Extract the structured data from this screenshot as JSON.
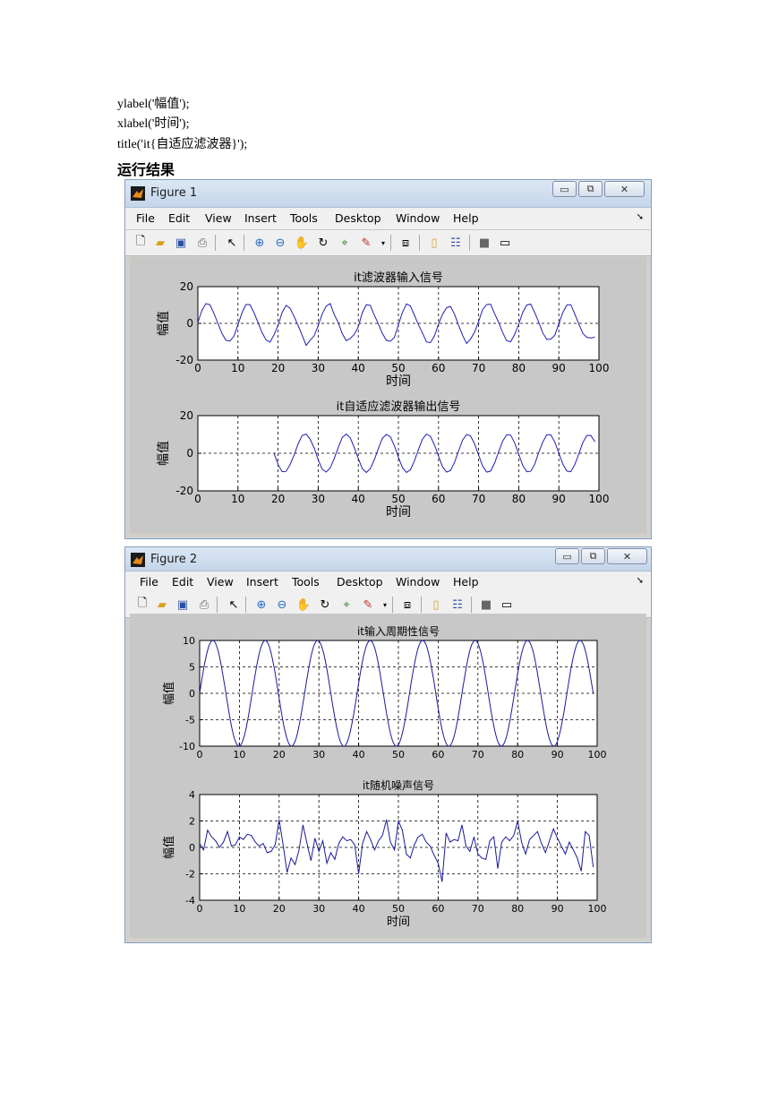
{
  "code": {
    "line1": "ylabel('幅值');",
    "line2": "xlabel('时间');",
    "line3": "title('it{自适应滤波器}');"
  },
  "heading": "运行结果",
  "figure1": {
    "title": "Figure 1",
    "menu": [
      "File",
      "Edit",
      "View",
      "Insert",
      "Tools",
      "Desktop",
      "Window",
      "Help"
    ],
    "plot_top_title": "it滤波器输入信号",
    "plot_bottom_title": "it自适应滤波器输出信号",
    "xlabel": "时间",
    "ylabel": "幅值"
  },
  "figure2": {
    "title": "Figure 2",
    "menu": [
      "File",
      "Edit",
      "View",
      "Insert",
      "Tools",
      "Desktop",
      "Window",
      "Help"
    ],
    "plot_top_title": "it输入周期性信号",
    "plot_bottom_title": "it随机噪声信号",
    "xlabel": "时间",
    "ylabel": "幅值"
  },
  "chart_data": [
    {
      "type": "line",
      "title": "it滤波器输入信号",
      "xlabel": "时间",
      "ylabel": "幅值",
      "xlim": [
        0,
        100
      ],
      "ylim": [
        -20,
        20
      ],
      "xticks": [
        0,
        10,
        20,
        30,
        40,
        50,
        60,
        70,
        80,
        90,
        100
      ],
      "yticks": [
        -20,
        0,
        20
      ],
      "grid": true,
      "series_color": "#1f1fb4",
      "x": [
        0,
        1,
        2,
        3,
        4,
        5,
        6,
        7,
        8,
        9,
        10,
        11,
        12,
        13,
        14,
        15,
        16,
        17,
        18,
        19,
        20,
        21,
        22,
        23,
        24,
        25,
        26,
        27,
        28,
        29,
        30,
        31,
        32,
        33,
        34,
        35,
        36,
        37,
        38,
        39,
        40,
        41,
        42,
        43,
        44,
        45,
        46,
        47,
        48,
        49,
        50,
        51,
        52,
        53,
        54,
        55,
        56,
        57,
        58,
        59,
        60,
        61,
        62,
        63,
        64,
        65,
        66,
        67,
        68,
        69,
        70,
        71,
        72,
        73,
        74,
        75,
        76,
        77,
        78,
        79,
        80,
        81,
        82,
        83,
        84,
        85,
        86,
        87,
        88,
        89,
        90,
        91,
        92,
        93,
        94,
        95,
        96,
        97,
        98,
        99
      ],
      "y": [
        0.5,
        7,
        10.8,
        10.2,
        5.5,
        0,
        -5.5,
        -9.2,
        -9.6,
        -7,
        -0.8,
        5.8,
        10.3,
        10.2,
        5.8,
        0.5,
        -5,
        -9,
        -10.2,
        -6.2,
        -1,
        6,
        9.8,
        8.2,
        3.8,
        -1.2,
        -6.5,
        -12,
        -9.2,
        -6.8,
        -1.2,
        5.2,
        9.4,
        10.8,
        4.8,
        0.5,
        -5.6,
        -9.4,
        -8.2,
        -6,
        -1.8,
        5.8,
        10.2,
        9.8,
        4.5,
        -0.2,
        -5.5,
        -9.2,
        -9.8,
        -7.6,
        -0.8,
        6,
        10.6,
        9.5,
        4.4,
        -0.8,
        -5.2,
        -10.1,
        -10.5,
        -6.8,
        -0.4,
        5,
        8.5,
        9.2,
        5,
        -1,
        -6.5,
        -11,
        -8.5,
        -4.8,
        1,
        7.5,
        10.2,
        10.5,
        5.2,
        0.5,
        -5,
        -9.5,
        -10,
        -6,
        -0.5,
        6,
        10,
        10.5,
        5.8,
        0.6,
        -5.2,
        -8.8,
        -8.6,
        -6.5,
        -0.2,
        6,
        10,
        10.2,
        5,
        -0.4,
        -5.5,
        -7.6,
        -8,
        -7.4
      ]
    },
    {
      "type": "line",
      "title": "it自适应滤波器输出信号",
      "xlabel": "时间",
      "ylabel": "幅值",
      "xlim": [
        0,
        100
      ],
      "ylim": [
        -20,
        20
      ],
      "xticks": [
        0,
        10,
        20,
        30,
        40,
        50,
        60,
        70,
        80,
        90,
        100
      ],
      "yticks": [
        -20,
        0,
        20
      ],
      "grid": true,
      "series_color": "#1f1fb4",
      "x": [
        19,
        20,
        21,
        22,
        23,
        24,
        25,
        26,
        27,
        28,
        29,
        30,
        31,
        32,
        33,
        34,
        35,
        36,
        37,
        38,
        39,
        40,
        41,
        42,
        43,
        44,
        45,
        46,
        47,
        48,
        49,
        50,
        51,
        52,
        53,
        54,
        55,
        56,
        57,
        58,
        59,
        60,
        61,
        62,
        63,
        64,
        65,
        66,
        67,
        68,
        69,
        70,
        71,
        72,
        73,
        74,
        75,
        76,
        77,
        78,
        79,
        80,
        81,
        82,
        83,
        84,
        85,
        86,
        87,
        88,
        89,
        90,
        91,
        92,
        93,
        94,
        95,
        96,
        97,
        98,
        99
      ],
      "y": [
        0,
        -6,
        -9.8,
        -9.6,
        -6,
        -1,
        5,
        9.5,
        10.2,
        7.5,
        2.8,
        -3.5,
        -8.5,
        -10,
        -7.8,
        -2.8,
        3,
        8.4,
        10.2,
        8.2,
        3,
        -2.8,
        -8.2,
        -10.2,
        -8.2,
        -3.5,
        2.5,
        8,
        10,
        8.8,
        4,
        -2.2,
        -7.6,
        -10.2,
        -8.8,
        -4,
        2,
        7.5,
        10.2,
        9,
        4.5,
        -1.5,
        -7.2,
        -10,
        -9.2,
        -4.8,
        1.2,
        7,
        10,
        9.2,
        5,
        -1,
        -6.8,
        -10,
        -9.5,
        -5.2,
        0.8,
        6.5,
        9.8,
        9.6,
        5.5,
        -0.5,
        -6.5,
        -9.8,
        -9.6,
        -5.8,
        0.5,
        6,
        9.8,
        9.8,
        6,
        0,
        -5.8,
        -9.5,
        -9.8,
        -6,
        -0.2,
        5.8,
        9.5,
        9.5,
        6,
        0.5,
        -5.5,
        -9,
        -8.5,
        -7,
        -5.5
      ]
    },
    {
      "type": "line",
      "title": "it输入周期性信号",
      "xlabel": "",
      "ylabel": "幅值",
      "xlim": [
        0,
        100
      ],
      "ylim": [
        -10,
        10
      ],
      "xticks": [
        0,
        10,
        20,
        30,
        40,
        50,
        60,
        70,
        80,
        90,
        100
      ],
      "yticks": [
        -10,
        -5,
        0,
        5,
        10
      ],
      "grid": true,
      "series_color": "#1a1a9a",
      "function": "10*sin(2*pi*x/13.2)",
      "period": 13.2,
      "amplitude": 10,
      "x_range": [
        0,
        99
      ]
    },
    {
      "type": "line",
      "title": "it随机噪声信号",
      "xlabel": "时间",
      "ylabel": "幅值",
      "xlim": [
        0,
        100
      ],
      "ylim": [
        -4,
        4
      ],
      "xticks": [
        0,
        10,
        20,
        30,
        40,
        50,
        60,
        70,
        80,
        90,
        100
      ],
      "yticks": [
        -4,
        -2,
        0,
        2,
        4
      ],
      "grid": true,
      "series_color": "#1a1a9a",
      "x": [
        0,
        1,
        2,
        3,
        4,
        5,
        6,
        7,
        8,
        9,
        10,
        11,
        12,
        13,
        14,
        15,
        16,
        17,
        18,
        19,
        20,
        21,
        22,
        23,
        24,
        25,
        26,
        27,
        28,
        29,
        30,
        31,
        32,
        33,
        34,
        35,
        36,
        37,
        38,
        39,
        40,
        41,
        42,
        43,
        44,
        45,
        46,
        47,
        48,
        49,
        50,
        51,
        52,
        53,
        54,
        55,
        56,
        57,
        58,
        59,
        60,
        61,
        62,
        63,
        64,
        65,
        66,
        67,
        68,
        69,
        70,
        71,
        72,
        73,
        74,
        75,
        76,
        77,
        78,
        79,
        80,
        81,
        82,
        83,
        84,
        85,
        86,
        87,
        88,
        89,
        90,
        91,
        92,
        93,
        94,
        95,
        96,
        97,
        98,
        99
      ],
      "y": [
        0.3,
        -0.2,
        1.3,
        0.8,
        0.5,
        0,
        0.4,
        1.2,
        0.1,
        0.2,
        0.8,
        0.6,
        1,
        0.9,
        0.4,
        0.1,
        0.3,
        -0.4,
        -0.3,
        0.2,
        2.1,
        0.2,
        -1.9,
        -0.8,
        -1.3,
        -0.2,
        1.7,
        0.3,
        -1,
        0.7,
        -0.3,
        0.5,
        -1.2,
        -0.4,
        -0.9,
        0.3,
        0.8,
        0.5,
        0.6,
        0.2,
        -2,
        0.3,
        1.2,
        0.6,
        -0.2,
        0.5,
        0.9,
        2.1,
        0.4,
        -0.2,
        2,
        1.3,
        -0.5,
        -0.8,
        0.2,
        0.8,
        1,
        0.4,
        0.1,
        -0.6,
        -1.2,
        -2.6,
        1.1,
        0.4,
        0.6,
        0.5,
        1.7,
        0.1,
        -0.3,
        0.8,
        -0.5,
        -0.8,
        -0.9,
        0.5,
        0.8,
        -1.6,
        0.4,
        0.8,
        0.5,
        0.9,
        2,
        0.4,
        -0.5,
        0.6,
        0.9,
        1.2,
        0.3,
        -0.4,
        0.5,
        1.4,
        0.7,
        0.1,
        -0.5,
        0.4,
        -0.2,
        -0.8,
        -1.8,
        1.2,
        0.9,
        -1.5
      ]
    }
  ]
}
